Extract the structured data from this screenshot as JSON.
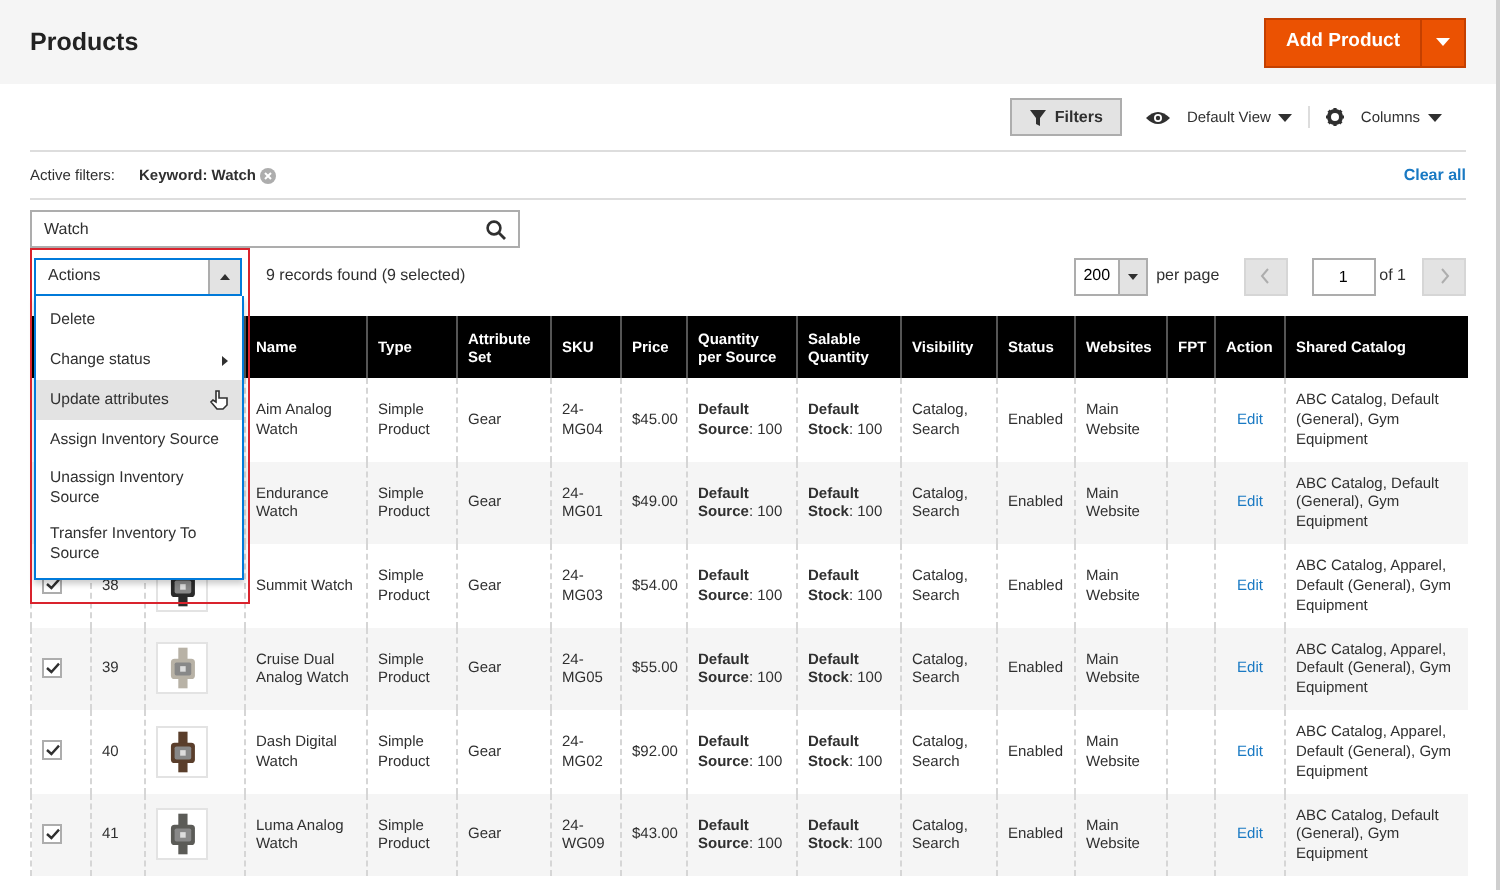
{
  "page_title": "Products",
  "add_button": {
    "label": "Add Product"
  },
  "toolbar": {
    "filters": "Filters",
    "view": "Default View",
    "columns": "Columns"
  },
  "active_filters": {
    "label": "Active filters:",
    "chips": [
      {
        "text": "Keyword: Watch"
      }
    ],
    "clear": "Clear all"
  },
  "search": {
    "value": "Watch"
  },
  "actions_select": {
    "value": "Actions",
    "expanded": true,
    "highlight_frame": true,
    "menu": [
      {
        "label": "Delete",
        "submenu": false,
        "hovered": false
      },
      {
        "label": "Change status",
        "submenu": true,
        "hovered": false
      },
      {
        "label": "Update attributes",
        "submenu": false,
        "hovered": true
      },
      {
        "label": "Assign Inventory Source",
        "submenu": false,
        "hovered": false
      },
      {
        "label": "Unassign Inventory Source",
        "submenu": false,
        "hovered": false
      },
      {
        "label": "Transfer Inventory To Source",
        "submenu": false,
        "hovered": false
      }
    ]
  },
  "records": "9 records found (9 selected)",
  "pager": {
    "per_page_value": "200",
    "per_page_label": "per page",
    "page": "1",
    "of": "of 1"
  },
  "table": {
    "columns": [
      "Name",
      "Type",
      "Attribute Set",
      "SKU",
      "Price",
      "Quantity per Source",
      "Salable Quantity",
      "Visibility",
      "Status",
      "Websites",
      "FPT",
      "Action",
      "Shared Catalog"
    ],
    "rows": [
      {
        "name": "Aim Analog Watch",
        "type": "Simple Product",
        "attribute_set": "Gear",
        "sku": "24-MG04",
        "price": "$45.00",
        "qty": "**Default Source**: 100",
        "salable": "**Default Stock**: 100",
        "visibility": "Catalog, Search",
        "status": "Enabled",
        "websites": "Main Website",
        "action": "Edit",
        "shared_catalog": "ABC Catalog, Default (General), Gym Equipment"
      },
      {
        "name": "Endurance Watch",
        "type": "Simple Product",
        "attribute_set": "Gear",
        "sku": "24-MG01",
        "price": "$49.00",
        "qty": "**Default Source**: 100",
        "salable": "**Default Stock**: 100",
        "visibility": "Catalog, Search",
        "status": "Enabled",
        "websites": "Main Website",
        "action": "Edit",
        "shared_catalog": "ABC Catalog, Default (General), Gym Equipment"
      },
      {
        "checked": true,
        "id": "38",
        "name": "Summit Watch",
        "type": "Simple Product",
        "attribute_set": "Gear",
        "sku": "24-MG03",
        "price": "$54.00",
        "qty": "**Default Source**: 100",
        "salable": "**Default Stock**: 100",
        "visibility": "Catalog, Search",
        "status": "Enabled",
        "websites": "Main Website",
        "action": "Edit",
        "shared_catalog": "ABC Catalog, Apparel, Default (General), Gym Equipment"
      },
      {
        "checked": true,
        "id": "39",
        "name": "Cruise Dual Analog Watch",
        "type": "Simple Product",
        "attribute_set": "Gear",
        "sku": "24-MG05",
        "price": "$55.00",
        "qty": "**Default Source**: 100",
        "salable": "**Default Stock**: 100",
        "visibility": "Catalog, Search",
        "status": "Enabled",
        "websites": "Main Website",
        "action": "Edit",
        "shared_catalog": "ABC Catalog, Apparel, Default (General), Gym Equipment"
      },
      {
        "checked": true,
        "id": "40",
        "name": "Dash Digital Watch",
        "type": "Simple Product",
        "attribute_set": "Gear",
        "sku": "24-MG02",
        "price": "$92.00",
        "qty": "**Default Source**: 100",
        "salable": "**Default Stock**: 100",
        "visibility": "Catalog, Search",
        "status": "Enabled",
        "websites": "Main Website",
        "action": "Edit",
        "shared_catalog": "ABC Catalog, Apparel, Default (General), Gym Equipment"
      },
      {
        "checked": true,
        "id": "41",
        "name": "Luma Analog Watch",
        "type": "Simple Product",
        "attribute_set": "Gear",
        "sku": "24-WG09",
        "price": "$43.00",
        "qty": "**Default Source**: 100",
        "salable": "**Default Stock**: 100",
        "visibility": "Catalog, Search",
        "status": "Enabled",
        "websites": "Main Website",
        "action": "Edit",
        "shared_catalog": "ABC Catalog, Default (General), Gym Equipment"
      }
    ]
  }
}
